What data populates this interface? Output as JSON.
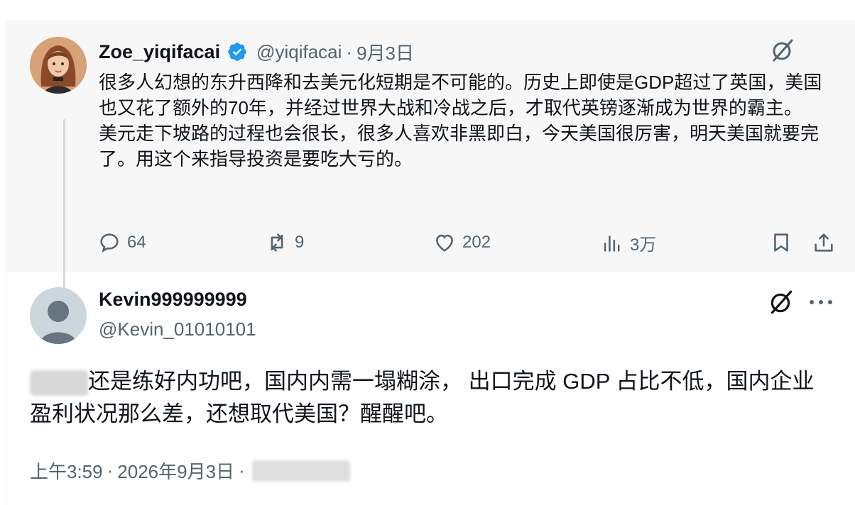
{
  "parent_tweet": {
    "display_name": "Zoe_yiqifacai",
    "handle": "@yiqifacai",
    "separator": "·",
    "date": "9月3日",
    "paragraph1": "很多人幻想的东升西降和去美元化短期是不可能的。历史上即使是GDP超过了英国，美国也又花了额外的70年，并经过世界大战和冷战之后，才取代英镑逐渐成为世界的霸主。",
    "paragraph2": "美元走下坡路的过程也会很长，很多人喜欢非黑即白，今天美国很厉害，明天美国就要完了。用这个来指导投资是要吃大亏的。",
    "replies": "64",
    "reposts": "9",
    "likes": "202",
    "views": "3万"
  },
  "reply_tweet": {
    "display_name": "Kevin999999999",
    "handle": "@Kevin_01010101",
    "text_rest": "还是练好内功吧，国内内需一塌糊涂， 出口完成 GDP 占比不低，国内企业盈利状况那么差，还想取代美国？醒醒吧。",
    "time": "上午3:59",
    "separator": "·",
    "date": "2026年9月3日",
    "separator2": "·"
  },
  "colors": {
    "secondary": "#536471",
    "verified": "#1d9bf0",
    "parent_bg": "#f7f7f7"
  },
  "icons": [
    "verified-badge-icon",
    "grok-icon",
    "reply-icon",
    "repost-icon",
    "like-icon",
    "views-icon",
    "bookmark-icon",
    "share-icon",
    "more-icon"
  ]
}
